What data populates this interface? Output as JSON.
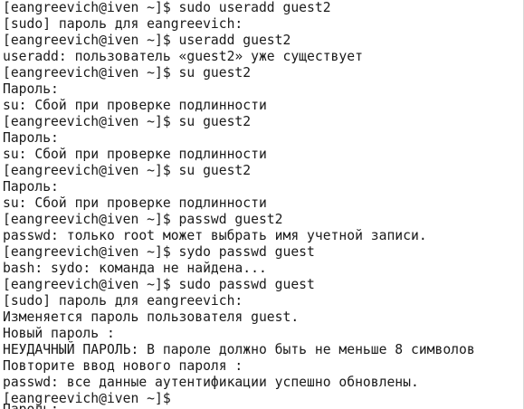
{
  "terminal": {
    "lines": [
      "[eangreevich@iven ~]$ sudo useradd guest2",
      "[sudo] пароль для eangreevich:",
      "[eangreevich@iven ~]$ useradd guest2",
      "useradd: пользователь «guest2» уже существует",
      "[eangreevich@iven ~]$ su guest2",
      "Пароль:",
      "su: Сбой при проверке подлинности",
      "[eangreevich@iven ~]$ su guest2",
      "Пароль:",
      "su: Сбой при проверке подлинности",
      "[eangreevich@iven ~]$ su guest2",
      "Пароль:",
      "su: Сбой при проверке подлинности",
      "[eangreevich@iven ~]$ passwd guest2",
      "passwd: только root может выбрать имя учетной записи.",
      "[eangreevich@iven ~]$ sydo passwd guest",
      "bash: sydo: команда не найдена...",
      "[eangreevich@iven ~]$ sudo passwd guest",
      "[sudo] пароль для eangreevich:",
      "Изменяется пароль пользователя guest.",
      "Новый пароль :",
      "НЕУДАЧНЫЙ ПАРОЛЬ: В пароле должно быть не меньше 8 символов",
      "Повторите ввод нового пароля :",
      "passwd: все данные аутентификации успешно обновлены.",
      "[eangreevich@iven ~]$ "
    ],
    "partial_line": "Пароль:"
  }
}
